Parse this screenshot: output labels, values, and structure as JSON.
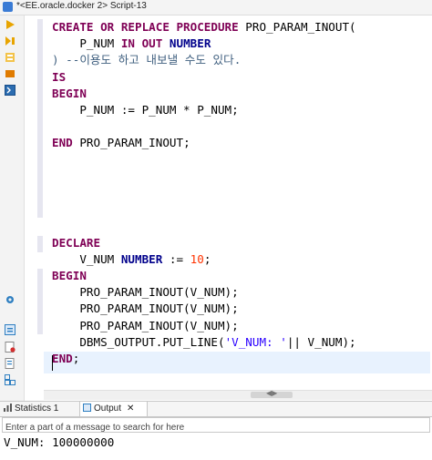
{
  "window": {
    "title": "*<EE.oracle.docker 2> Script-13"
  },
  "editor": {
    "lines": [
      {
        "tokens": [
          {
            "t": "CREATE OR REPLACE PROCEDURE",
            "c": "kw"
          },
          {
            "t": " PRO_PARAM_INOUT(",
            "c": ""
          }
        ]
      },
      {
        "tokens": [
          {
            "t": "    P_NUM ",
            "c": ""
          },
          {
            "t": "IN OUT",
            "c": "kw"
          },
          {
            "t": " ",
            "c": ""
          },
          {
            "t": "NUMBER",
            "c": "typ"
          }
        ]
      },
      {
        "tokens": [
          {
            "t": ") --이용도 하고 내보낼 수도 있다.",
            "c": "cmt"
          }
        ]
      },
      {
        "tokens": [
          {
            "t": "IS",
            "c": "kw"
          }
        ]
      },
      {
        "tokens": [
          {
            "t": "BEGIN",
            "c": "kw"
          }
        ]
      },
      {
        "tokens": [
          {
            "t": "    P_NUM := P_NUM * P_NUM;",
            "c": ""
          }
        ]
      },
      {
        "tokens": [
          {
            "t": "",
            "c": ""
          }
        ]
      },
      {
        "tokens": [
          {
            "t": "END",
            "c": "kw"
          },
          {
            "t": " PRO_PARAM_INOUT;",
            "c": ""
          }
        ]
      },
      {
        "tokens": [
          {
            "t": "",
            "c": ""
          }
        ]
      },
      {
        "tokens": [
          {
            "t": "",
            "c": ""
          }
        ]
      },
      {
        "tokens": [
          {
            "t": "",
            "c": ""
          }
        ]
      },
      {
        "tokens": [
          {
            "t": "",
            "c": ""
          }
        ]
      },
      {
        "tokens": [
          {
            "t": "",
            "c": ""
          }
        ]
      },
      {
        "tokens": [
          {
            "t": "DECLARE",
            "c": "kw"
          }
        ]
      },
      {
        "tokens": [
          {
            "t": "    V_NUM ",
            "c": ""
          },
          {
            "t": "NUMBER",
            "c": "typ"
          },
          {
            "t": " := ",
            "c": ""
          },
          {
            "t": "10",
            "c": "num"
          },
          {
            "t": ";",
            "c": ""
          }
        ]
      },
      {
        "tokens": [
          {
            "t": "BEGIN",
            "c": "kw"
          }
        ]
      },
      {
        "tokens": [
          {
            "t": "    PRO_PARAM_INOUT(V_NUM);",
            "c": ""
          }
        ]
      },
      {
        "tokens": [
          {
            "t": "    PRO_PARAM_INOUT(V_NUM);",
            "c": ""
          }
        ]
      },
      {
        "tokens": [
          {
            "t": "    PRO_PARAM_INOUT(V_NUM);",
            "c": ""
          }
        ]
      },
      {
        "tokens": [
          {
            "t": "    DBMS_OUTPUT.PUT_LINE(",
            "c": ""
          },
          {
            "t": "'V_NUM: '",
            "c": "str"
          },
          {
            "t": "|| V_NUM);",
            "c": ""
          }
        ]
      },
      {
        "tokens": [
          {
            "t": "END",
            "c": "kw"
          },
          {
            "t": ";",
            "c": ""
          }
        ]
      },
      {
        "tokens": [
          {
            "t": "",
            "c": ""
          }
        ]
      }
    ]
  },
  "panel": {
    "tabs": [
      {
        "label": "Statistics 1"
      },
      {
        "label": "Output"
      }
    ],
    "close_glyph": "✕",
    "filter_placeholder": "Enter a part of a message to search for here",
    "output_text": "V_NUM: 100000000"
  },
  "hscroll_arrows": "◀▶",
  "colors": {
    "keyword": "#7f0055",
    "type": "#00008b",
    "number": "#ff3300",
    "comment": "#3f5f7f",
    "string": "#2a00ff"
  }
}
